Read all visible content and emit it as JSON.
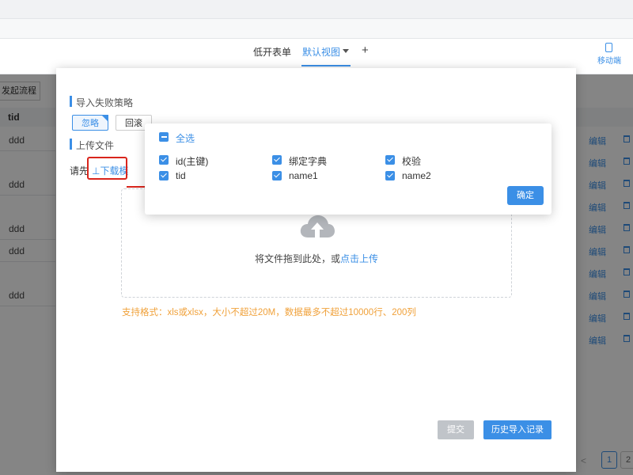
{
  "header": {
    "form_title": "低开表单",
    "view_label": "默认视图",
    "add_view": "+",
    "mobile_label": "移动端"
  },
  "background": {
    "start_flow_button": "发起流程",
    "table": {
      "column_header": "tid",
      "cells": [
        "ddd",
        "ddd",
        "ddd",
        "ddd",
        "ddd"
      ]
    },
    "row_action": "编辑",
    "pager": {
      "prev": "<",
      "page1": "1",
      "page2": "2"
    }
  },
  "modal": {
    "import_strategy": {
      "title": "导入失败策略",
      "options": [
        "忽略",
        "回滚"
      ],
      "selected": "忽略"
    },
    "upload": {
      "title": "上传文件",
      "prefix": "请先",
      "download_template": "⊥下载模",
      "dropzone_text": "将文件拖到此处，或",
      "dropzone_link": "点击上传",
      "hint": "支持格式：xls或xlsx，大小不超过20M，数据最多不超过10000行、200列"
    },
    "buttons": {
      "submit": "提交",
      "history": "历史导入记录"
    }
  },
  "field_popover": {
    "select_all": "全选",
    "fields": [
      "id(主键)",
      "绑定字典",
      "校验",
      "tid",
      "name1",
      "name2"
    ],
    "confirm": "确定"
  },
  "colors": {
    "accent": "#3b8fe6",
    "annotation": "#d9251c",
    "hint": "#f0a13a"
  }
}
